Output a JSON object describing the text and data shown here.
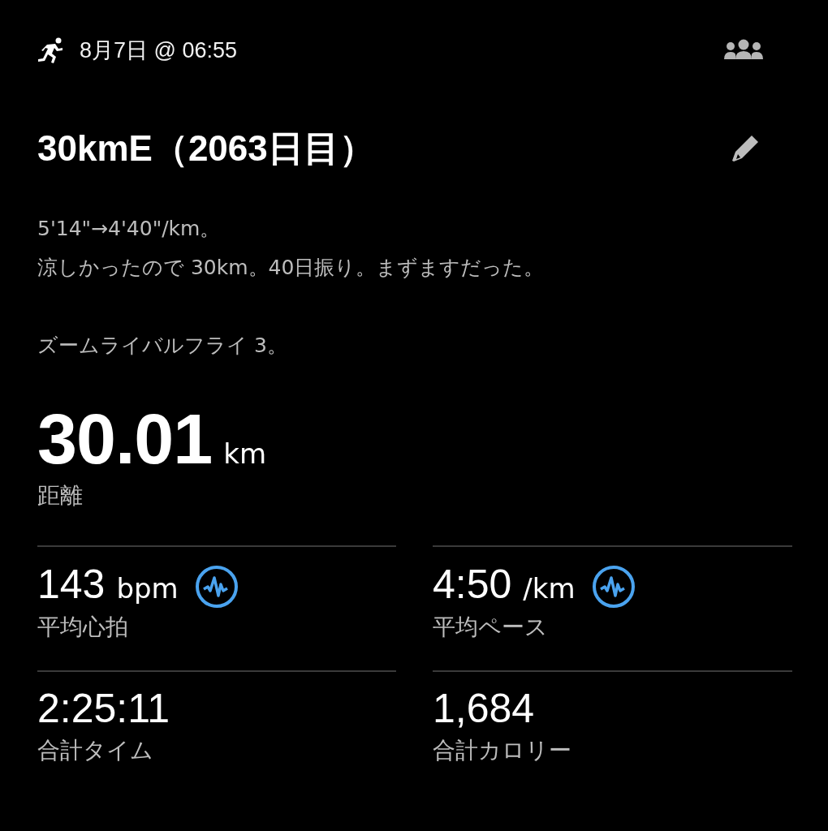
{
  "header": {
    "datetime": "8月7日 @ 06:55"
  },
  "activity": {
    "title": "30kmE（2063日目）",
    "description": [
      {
        "lines": [
          "5'14\"→4'40\"/km。",
          "涼しかったので 30km。40日振り。まずますだった。"
        ]
      },
      {
        "lines": [
          "ズームライバルフライ 3。"
        ]
      }
    ]
  },
  "distance": {
    "value": "30.01",
    "unit": "km",
    "label": "距離"
  },
  "stats": [
    {
      "kind": "chart",
      "value": "143",
      "unit": "bpm",
      "label": "平均心拍"
    },
    {
      "kind": "chart",
      "value": "4:50",
      "unit": "/km",
      "label": "平均ペース"
    },
    {
      "kind": "plain",
      "value": "2:25:11",
      "label": "合計タイム"
    },
    {
      "kind": "plain",
      "value": "1,684",
      "label": "合計カロリー"
    }
  ]
}
